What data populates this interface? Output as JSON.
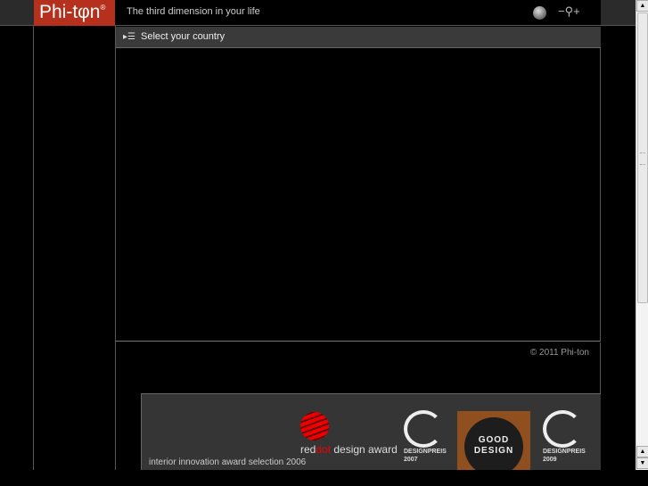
{
  "header": {
    "logo": "Phi-tφn",
    "logo_mark": "®",
    "tagline": "The third dimension in your life",
    "zoom_out": "−",
    "zoom_in": "+",
    "globe_icon": "globe-icon",
    "zoom_icon": "magnifier-icon"
  },
  "country": {
    "label": "Select your country"
  },
  "footer": {
    "copyright": "© 2011 Phi-ton"
  },
  "awards": {
    "innovation": "interior innovation award selection 2006",
    "reddot_prefix": "red",
    "reddot_dot": "dot",
    "reddot_suffix": " design award",
    "designpreis_1": "DESIGNPREIS",
    "year_1": "2007",
    "good_design": "GOOD DESIGN",
    "designpreis_2": "DESIGNPREIS",
    "year_2": "2009"
  },
  "colors": {
    "brand": "#b5311e"
  }
}
